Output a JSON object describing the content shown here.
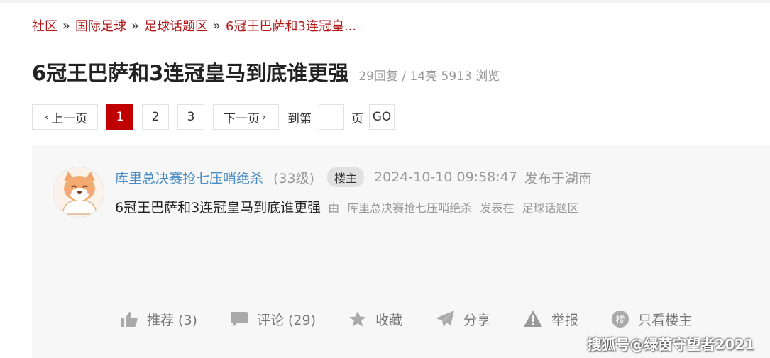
{
  "breadcrumb": {
    "items": [
      "社区",
      "国际足球",
      "足球话题区",
      "6冠王巴萨和3连冠皇..."
    ],
    "separator": "»"
  },
  "thread": {
    "title": "6冠王巴萨和3连冠皇马到底谁更强",
    "stats": "29回复 / 14亮 5913 浏览"
  },
  "pager": {
    "prev_label": "上一页",
    "pages": [
      "1",
      "2",
      "3"
    ],
    "current": "1",
    "next_label": "下一页",
    "goto_prefix": "到第",
    "goto_suffix": "页",
    "go_label": "GO"
  },
  "post": {
    "author": "库里总决赛抢七压哨绝杀",
    "level": "(33级)",
    "badge": "楼主",
    "time": "2024-10-10 09:58:47",
    "location": "发布于湖南",
    "subtitle": "6冠王巴萨和3连冠皇马到底谁更强",
    "by": "由",
    "by_author": "库里总决赛抢七压哨绝杀",
    "posted_in": "发表在",
    "board": "足球话题区"
  },
  "actions": {
    "recommend": "推荐 (3)",
    "comment": "评论 (29)",
    "favorite": "收藏",
    "share": "分享",
    "report": "举报",
    "only_op": "只看楼主"
  },
  "watermark": "搜狐号@绿茵守望者2021",
  "colors": {
    "accent": "#b3191b",
    "active_page": "#c00000",
    "author_link": "#4a8cc4"
  }
}
